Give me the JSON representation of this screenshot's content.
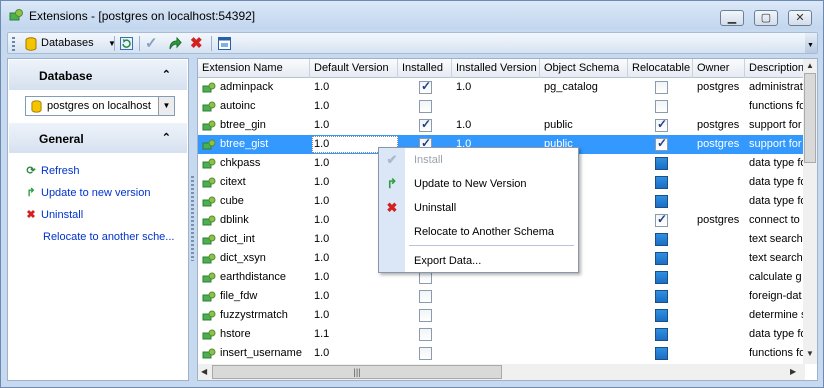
{
  "window": {
    "title": "Extensions - [postgres on localhost:54392]"
  },
  "toolbar": {
    "databases_label": "Databases"
  },
  "left_panel": {
    "database_header": "Database",
    "database_combo": "postgres on localhost",
    "general_header": "General",
    "actions": [
      {
        "label": "Refresh",
        "icon": "refresh-icon"
      },
      {
        "label": "Update to new version",
        "icon": "update-arrow-icon"
      },
      {
        "label": "Uninstall",
        "icon": "delete-x-icon"
      },
      {
        "label": "Relocate to another sche..."
      }
    ]
  },
  "grid": {
    "columns": [
      "Extension Name",
      "Default Version",
      "Installed",
      "Installed Version",
      "Object Schema",
      "Relocatable",
      "Owner",
      "Description"
    ],
    "rows": [
      {
        "name": "adminpack",
        "default_version": "1.0",
        "installed": true,
        "installed_version": "1.0",
        "schema": "pg_catalog",
        "relocatable": false,
        "owner": "postgres",
        "description": "administrat"
      },
      {
        "name": "autoinc",
        "default_version": "1.0",
        "installed": false,
        "installed_version": "",
        "schema": "",
        "relocatable": false,
        "owner": "",
        "description": "functions fo"
      },
      {
        "name": "btree_gin",
        "default_version": "1.0",
        "installed": true,
        "installed_version": "1.0",
        "schema": "public",
        "relocatable": true,
        "owner": "postgres",
        "description": "support for"
      },
      {
        "name": "btree_gist",
        "default_version": "1.0",
        "installed": true,
        "installed_version": "1.0",
        "schema": "public",
        "relocatable": true,
        "owner": "postgres",
        "description": "support for"
      },
      {
        "name": "chkpass",
        "default_version": "1.0",
        "installed": false,
        "installed_version": "",
        "schema": "",
        "relocatable": false,
        "owner": "",
        "description": "data type fo"
      },
      {
        "name": "citext",
        "default_version": "1.0",
        "installed": false,
        "installed_version": "",
        "schema": "",
        "relocatable": false,
        "owner": "",
        "description": "data type fo"
      },
      {
        "name": "cube",
        "default_version": "1.0",
        "installed": false,
        "installed_version": "",
        "schema": "",
        "relocatable": false,
        "owner": "",
        "description": "data type fo"
      },
      {
        "name": "dblink",
        "default_version": "1.0",
        "installed": false,
        "installed_version": "",
        "schema": "",
        "relocatable": true,
        "owner": "postgres",
        "description": "connect to"
      },
      {
        "name": "dict_int",
        "default_version": "1.0",
        "installed": false,
        "installed_version": "",
        "schema": "",
        "relocatable": false,
        "owner": "",
        "description": "text search"
      },
      {
        "name": "dict_xsyn",
        "default_version": "1.0",
        "installed": false,
        "installed_version": "",
        "schema": "",
        "relocatable": false,
        "owner": "",
        "description": "text search"
      },
      {
        "name": "earthdistance",
        "default_version": "1.0",
        "installed": false,
        "installed_version": "",
        "schema": "",
        "relocatable": false,
        "owner": "",
        "description": "calculate g"
      },
      {
        "name": "file_fdw",
        "default_version": "1.0",
        "installed": false,
        "installed_version": "",
        "schema": "",
        "relocatable": false,
        "owner": "",
        "description": "foreign-dat"
      },
      {
        "name": "fuzzystrmatch",
        "default_version": "1.0",
        "installed": false,
        "installed_version": "",
        "schema": "",
        "relocatable": false,
        "owner": "",
        "description": "determine s"
      },
      {
        "name": "hstore",
        "default_version": "1.1",
        "installed": false,
        "installed_version": "",
        "schema": "",
        "relocatable": false,
        "owner": "",
        "description": "data type fo"
      },
      {
        "name": "insert_username",
        "default_version": "1.0",
        "installed": false,
        "installed_version": "",
        "schema": "",
        "relocatable": false,
        "owner": "",
        "description": "functions fo"
      }
    ],
    "selected_row": 3
  },
  "context_menu": {
    "items": [
      {
        "label": "Install",
        "icon": "check-icon",
        "disabled": true
      },
      {
        "label": "Update to New Version",
        "icon": "update-arrow-icon",
        "disabled": false
      },
      {
        "label": "Uninstall",
        "icon": "delete-x-icon",
        "disabled": false
      },
      {
        "label": "Relocate to Another Schema",
        "icon": "",
        "disabled": false
      }
    ],
    "after_separator": {
      "label": "Export Data..."
    }
  },
  "colors": {
    "selection": "#3399ff",
    "link": "#0033cc",
    "window_frame": "#c7d9ee"
  }
}
